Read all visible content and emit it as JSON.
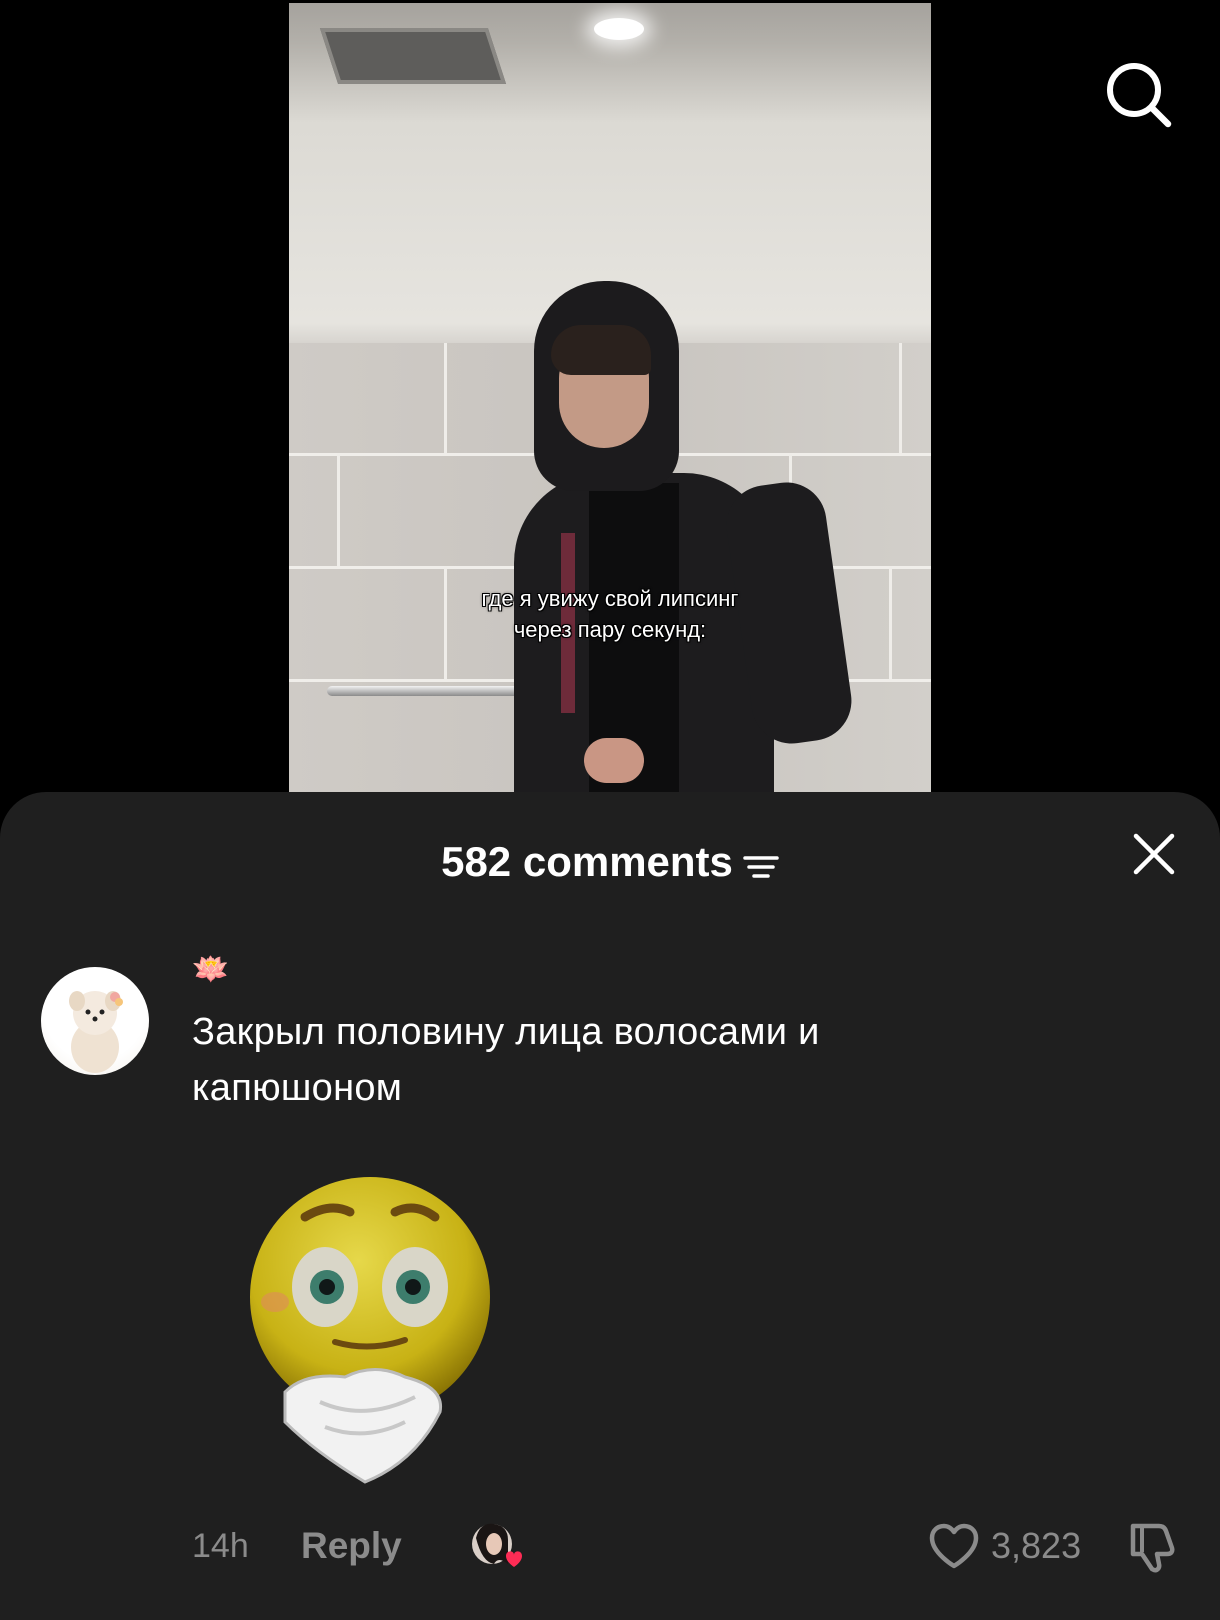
{
  "video": {
    "caption_line1": "где я увижу свой липсинг",
    "caption_line2": "через пару секунд:"
  },
  "header_icons": {
    "search": "search-icon"
  },
  "comments_sheet": {
    "title": "582 comments",
    "filter_icon": "filter-icon",
    "close_icon": "close-icon"
  },
  "comment": {
    "username": "🪷",
    "text": "Закрыл половину лица волосами и капюшоном",
    "sticker": "blushing-emoji-sticker",
    "time": "14h",
    "reply_label": "Reply",
    "like_count": "3,823",
    "like_icon": "heart-outline-icon",
    "dislike_icon": "thumbs-down-icon",
    "creator_liked_icon": "creator-liked-badge"
  },
  "colors": {
    "sheet_bg": "#1f1f1f",
    "secondary_text": "#8b8b8b",
    "heart_accent": "#fe2c55"
  }
}
